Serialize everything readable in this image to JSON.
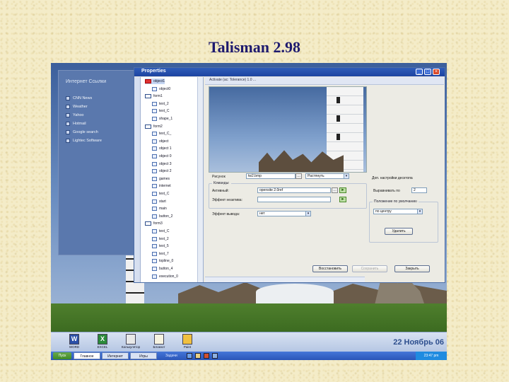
{
  "slide": {
    "title": "Talisman 2.98"
  },
  "left_panel": {
    "title": "Интернет Ссылки",
    "items": [
      "CNN News",
      "Weather",
      "Yahoo",
      "Hotmail",
      "Google search",
      "Lightec Software"
    ]
  },
  "window": {
    "title": "Properties",
    "pane_header": "Activate (ac: Tolerance) 1.0 ...",
    "tree": [
      {
        "label": "object1",
        "type": "folder",
        "selected": true
      },
      {
        "label": "object0",
        "type": "item"
      },
      {
        "label": "form1",
        "type": "folder"
      },
      {
        "label": "text_2",
        "type": "item"
      },
      {
        "label": "text_C",
        "type": "item"
      },
      {
        "label": "shape_1",
        "type": "item"
      },
      {
        "label": "form2",
        "type": "folder"
      },
      {
        "label": "text_C_",
        "type": "item"
      },
      {
        "label": "object",
        "type": "item"
      },
      {
        "label": "object 1",
        "type": "item"
      },
      {
        "label": "object 0",
        "type": "item"
      },
      {
        "label": "object 3",
        "type": "item"
      },
      {
        "label": "object 2",
        "type": "item"
      },
      {
        "label": "games",
        "type": "item"
      },
      {
        "label": "internet",
        "type": "item"
      },
      {
        "label": "text_C",
        "type": "item"
      },
      {
        "label": "start",
        "type": "item"
      },
      {
        "label": "main",
        "type": "item"
      },
      {
        "label": "button_2",
        "type": "item"
      },
      {
        "label": "form3",
        "type": "folder"
      },
      {
        "label": "text_C",
        "type": "item"
      },
      {
        "label": "text_2",
        "type": "item"
      },
      {
        "label": "text_5",
        "type": "item"
      },
      {
        "label": "text_7",
        "type": "item"
      },
      {
        "label": "topline_0",
        "type": "item"
      },
      {
        "label": "button_4",
        "type": "item"
      },
      {
        "label": "execution_0",
        "type": "item"
      }
    ],
    "form": {
      "picture_label": "Рисунок",
      "picture_value": "tw2.bmp",
      "picture_mode": "Растянуть",
      "commands_label": "Команды:",
      "active_label": "Активный:",
      "active_value": "opensite 2.0ref",
      "inactive_label": "Эффект неактива:",
      "inactive_value": "",
      "effect_label": "Эффект вывода:",
      "effect_value": "нет",
      "desktop_settings": "Доп. настройки десктопа",
      "snap_label": "Выравнивать по",
      "snap_value": "2",
      "pos_group": "Положение по умолчанию",
      "pos_value": "по центру",
      "apply_button": "Удалить"
    },
    "buttons": {
      "restore": "Восстановить",
      "disabled": "Сохранить",
      "close": "Закрыть"
    }
  },
  "dock": {
    "items": [
      {
        "label": "WORD",
        "icon": "word-icon",
        "glyph": "W",
        "color": "#2a4fa8"
      },
      {
        "label": "EXCEL",
        "icon": "excel-icon",
        "glyph": "X",
        "color": "#2a8a3a"
      },
      {
        "label": "Калькулятор",
        "icon": "calculator-icon",
        "glyph": "",
        "color": "#e8e8e8"
      },
      {
        "label": "Блокнот",
        "icon": "notepad-icon",
        "glyph": "",
        "color": "#f7f3e0"
      },
      {
        "label": "Paint",
        "icon": "paint-icon",
        "glyph": "",
        "color": "#f0c040"
      }
    ],
    "date": "22 Ноябрь 06"
  },
  "taskbar": {
    "start": "Пуск",
    "tabs": [
      "Главное",
      "Интернет",
      "Игры"
    ],
    "active_tab": 0,
    "task": "Задачи",
    "clock": "23:47 pm"
  }
}
